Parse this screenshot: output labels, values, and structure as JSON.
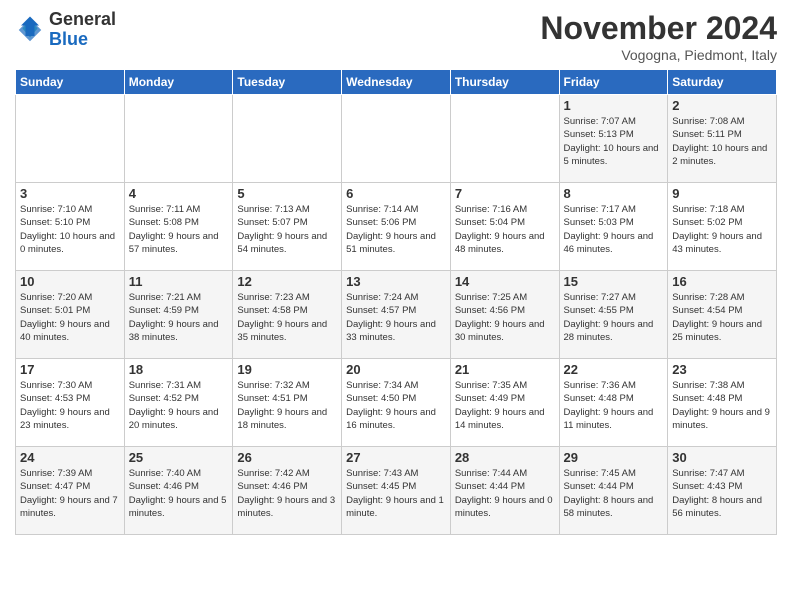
{
  "header": {
    "logo_general": "General",
    "logo_blue": "Blue",
    "title": "November 2024",
    "subtitle": "Vogogna, Piedmont, Italy"
  },
  "days_of_week": [
    "Sunday",
    "Monday",
    "Tuesday",
    "Wednesday",
    "Thursday",
    "Friday",
    "Saturday"
  ],
  "weeks": [
    [
      {
        "day": "",
        "info": ""
      },
      {
        "day": "",
        "info": ""
      },
      {
        "day": "",
        "info": ""
      },
      {
        "day": "",
        "info": ""
      },
      {
        "day": "",
        "info": ""
      },
      {
        "day": "1",
        "info": "Sunrise: 7:07 AM\nSunset: 5:13 PM\nDaylight: 10 hours and 5 minutes."
      },
      {
        "day": "2",
        "info": "Sunrise: 7:08 AM\nSunset: 5:11 PM\nDaylight: 10 hours and 2 minutes."
      }
    ],
    [
      {
        "day": "3",
        "info": "Sunrise: 7:10 AM\nSunset: 5:10 PM\nDaylight: 10 hours and 0 minutes."
      },
      {
        "day": "4",
        "info": "Sunrise: 7:11 AM\nSunset: 5:08 PM\nDaylight: 9 hours and 57 minutes."
      },
      {
        "day": "5",
        "info": "Sunrise: 7:13 AM\nSunset: 5:07 PM\nDaylight: 9 hours and 54 minutes."
      },
      {
        "day": "6",
        "info": "Sunrise: 7:14 AM\nSunset: 5:06 PM\nDaylight: 9 hours and 51 minutes."
      },
      {
        "day": "7",
        "info": "Sunrise: 7:16 AM\nSunset: 5:04 PM\nDaylight: 9 hours and 48 minutes."
      },
      {
        "day": "8",
        "info": "Sunrise: 7:17 AM\nSunset: 5:03 PM\nDaylight: 9 hours and 46 minutes."
      },
      {
        "day": "9",
        "info": "Sunrise: 7:18 AM\nSunset: 5:02 PM\nDaylight: 9 hours and 43 minutes."
      }
    ],
    [
      {
        "day": "10",
        "info": "Sunrise: 7:20 AM\nSunset: 5:01 PM\nDaylight: 9 hours and 40 minutes."
      },
      {
        "day": "11",
        "info": "Sunrise: 7:21 AM\nSunset: 4:59 PM\nDaylight: 9 hours and 38 minutes."
      },
      {
        "day": "12",
        "info": "Sunrise: 7:23 AM\nSunset: 4:58 PM\nDaylight: 9 hours and 35 minutes."
      },
      {
        "day": "13",
        "info": "Sunrise: 7:24 AM\nSunset: 4:57 PM\nDaylight: 9 hours and 33 minutes."
      },
      {
        "day": "14",
        "info": "Sunrise: 7:25 AM\nSunset: 4:56 PM\nDaylight: 9 hours and 30 minutes."
      },
      {
        "day": "15",
        "info": "Sunrise: 7:27 AM\nSunset: 4:55 PM\nDaylight: 9 hours and 28 minutes."
      },
      {
        "day": "16",
        "info": "Sunrise: 7:28 AM\nSunset: 4:54 PM\nDaylight: 9 hours and 25 minutes."
      }
    ],
    [
      {
        "day": "17",
        "info": "Sunrise: 7:30 AM\nSunset: 4:53 PM\nDaylight: 9 hours and 23 minutes."
      },
      {
        "day": "18",
        "info": "Sunrise: 7:31 AM\nSunset: 4:52 PM\nDaylight: 9 hours and 20 minutes."
      },
      {
        "day": "19",
        "info": "Sunrise: 7:32 AM\nSunset: 4:51 PM\nDaylight: 9 hours and 18 minutes."
      },
      {
        "day": "20",
        "info": "Sunrise: 7:34 AM\nSunset: 4:50 PM\nDaylight: 9 hours and 16 minutes."
      },
      {
        "day": "21",
        "info": "Sunrise: 7:35 AM\nSunset: 4:49 PM\nDaylight: 9 hours and 14 minutes."
      },
      {
        "day": "22",
        "info": "Sunrise: 7:36 AM\nSunset: 4:48 PM\nDaylight: 9 hours and 11 minutes."
      },
      {
        "day": "23",
        "info": "Sunrise: 7:38 AM\nSunset: 4:48 PM\nDaylight: 9 hours and 9 minutes."
      }
    ],
    [
      {
        "day": "24",
        "info": "Sunrise: 7:39 AM\nSunset: 4:47 PM\nDaylight: 9 hours and 7 minutes."
      },
      {
        "day": "25",
        "info": "Sunrise: 7:40 AM\nSunset: 4:46 PM\nDaylight: 9 hours and 5 minutes."
      },
      {
        "day": "26",
        "info": "Sunrise: 7:42 AM\nSunset: 4:46 PM\nDaylight: 9 hours and 3 minutes."
      },
      {
        "day": "27",
        "info": "Sunrise: 7:43 AM\nSunset: 4:45 PM\nDaylight: 9 hours and 1 minute."
      },
      {
        "day": "28",
        "info": "Sunrise: 7:44 AM\nSunset: 4:44 PM\nDaylight: 9 hours and 0 minutes."
      },
      {
        "day": "29",
        "info": "Sunrise: 7:45 AM\nSunset: 4:44 PM\nDaylight: 8 hours and 58 minutes."
      },
      {
        "day": "30",
        "info": "Sunrise: 7:47 AM\nSunset: 4:43 PM\nDaylight: 8 hours and 56 minutes."
      }
    ]
  ]
}
